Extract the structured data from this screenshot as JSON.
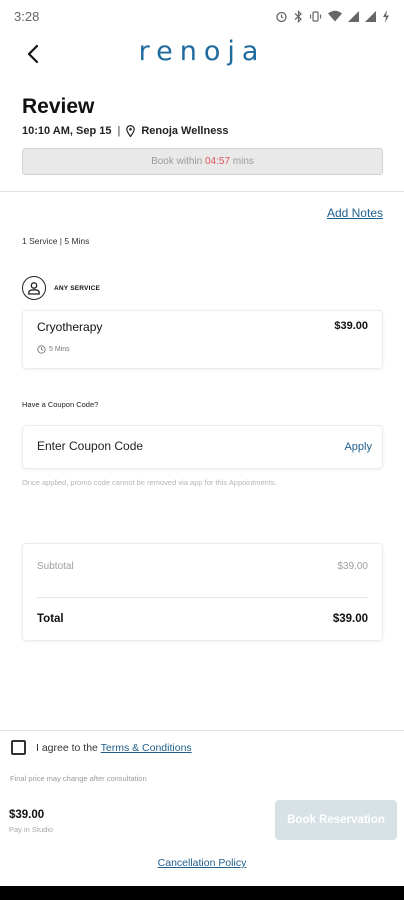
{
  "status_bar": {
    "time": "3:28",
    "icons": [
      "alarm-icon",
      "bluetooth-icon",
      "vibrate-icon",
      "wifi-icon",
      "signal-icon",
      "signal-icon",
      "battery-charging-icon"
    ]
  },
  "header": {
    "logo": "renoja",
    "back_icon": "chevron-left-icon",
    "logo_color": "#1f6b9e"
  },
  "review": {
    "title": "Review",
    "datetime": "10:10 AM, Sep 15",
    "separator": "|",
    "location": "Renoja Wellness",
    "timer_prefix": "Book within",
    "timer_value": "04:57",
    "timer_suffix": "mins"
  },
  "notes": {
    "add_notes_label": "Add Notes"
  },
  "services": {
    "summary": "1 Service | 5 Mins",
    "provider_label": "ANY SERVICE",
    "items": [
      {
        "name": "Cryotherapy",
        "price": "$39.00",
        "duration": "5 Mins"
      }
    ]
  },
  "coupon": {
    "question": "Have a Coupon Code?",
    "placeholder": "Enter Coupon Code",
    "apply_label": "Apply",
    "note": "Once applied, promo code cannot be removed via app for this Appointments."
  },
  "totals": {
    "subtotal_label": "Subtotal",
    "subtotal_value": "$39.00",
    "total_label": "Total",
    "total_value": "$39.00"
  },
  "agreement": {
    "prefix": "I agree to the",
    "terms_link": "Terms & Conditions",
    "checked": false,
    "price_note": "Final price may change after consultation"
  },
  "footer": {
    "price": "$39.00",
    "pay_note": "Pay in Studio",
    "book_button": "Book Reservation",
    "cancellation_link": "Cancellation Policy"
  },
  "colors": {
    "accent": "#1f5f8b",
    "timer_highlight": "#e0575f",
    "disabled_button": "#d8e1e6"
  }
}
